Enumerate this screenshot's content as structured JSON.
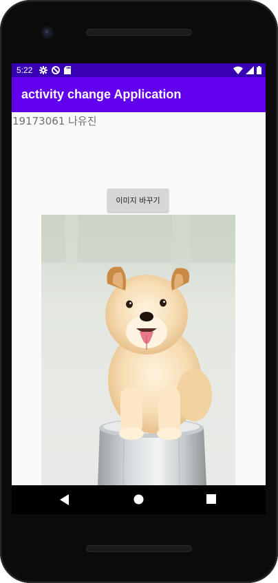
{
  "status_bar": {
    "time": "5:22",
    "icons_left": [
      "settings-icon",
      "do-not-disturb-icon",
      "sd-card-icon"
    ],
    "icons_right": [
      "wifi-icon",
      "signal-icon",
      "battery-icon"
    ],
    "color": "#3700b3"
  },
  "app_bar": {
    "title": "activity change Application",
    "color": "#6200ee"
  },
  "content": {
    "student_text": "19173061 나유진",
    "button_label": "이미지 바꾸기",
    "image": "puppy-photo"
  },
  "nav_bar": {
    "buttons": [
      "back-icon",
      "home-icon",
      "recents-icon"
    ]
  }
}
